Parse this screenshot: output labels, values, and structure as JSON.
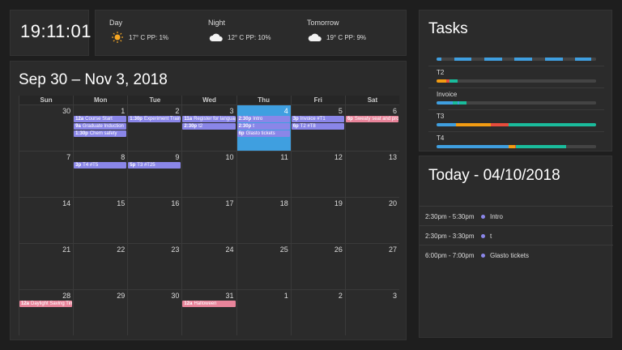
{
  "clock": {
    "time": "19:11:01"
  },
  "weather": [
    {
      "label": "Day",
      "icon": "sun-icon",
      "text": "17° C PP: 1%"
    },
    {
      "label": "Night",
      "icon": "cloud-icon",
      "text": "12° C PP: 10%"
    },
    {
      "label": "Tomorrow",
      "icon": "cloud-icon",
      "text": "19° C PP: 9%"
    }
  ],
  "calendar": {
    "title": "Sep 30 – Nov 3, 2018",
    "weekdays": [
      "Sun",
      "Mon",
      "Tue",
      "Wed",
      "Thu",
      "Fri",
      "Sat"
    ],
    "weeks": [
      [
        30,
        1,
        2,
        3,
        4,
        5,
        6
      ],
      [
        7,
        8,
        9,
        10,
        11,
        12,
        13
      ],
      [
        14,
        15,
        16,
        17,
        18,
        19,
        20
      ],
      [
        21,
        22,
        23,
        24,
        25,
        26,
        27
      ],
      [
        28,
        29,
        30,
        31,
        1,
        2,
        3
      ]
    ],
    "today": {
      "week": 0,
      "day": 4
    },
    "events": [
      {
        "week": 0,
        "day": 1,
        "slot": 0,
        "time": "12a",
        "title": "Course Start",
        "color": "purple"
      },
      {
        "week": 0,
        "day": 1,
        "slot": 1,
        "time": "9a",
        "title": "Graduate Induction",
        "color": "purple"
      },
      {
        "week": 0,
        "day": 1,
        "slot": 2,
        "time": "1:30p",
        "title": "Chem safety",
        "color": "purple"
      },
      {
        "week": 0,
        "day": 2,
        "slot": 0,
        "time": "1:30p",
        "title": "Experiment Training",
        "color": "purple"
      },
      {
        "week": 0,
        "day": 3,
        "slot": 0,
        "time": "11a",
        "title": "Register for language",
        "color": "purple"
      },
      {
        "week": 0,
        "day": 3,
        "slot": 1,
        "time": "2:30p",
        "title": "t2",
        "color": "purple"
      },
      {
        "week": 0,
        "day": 4,
        "slot": 0,
        "time": "2:30p",
        "title": "Intro",
        "color": "purple"
      },
      {
        "week": 0,
        "day": 4,
        "slot": 1,
        "time": "2:30p",
        "title": "t",
        "color": "purple"
      },
      {
        "week": 0,
        "day": 4,
        "slot": 2,
        "time": "6p",
        "title": "Glasto tickets",
        "color": "purple"
      },
      {
        "week": 0,
        "day": 5,
        "slot": 0,
        "time": "3p",
        "title": "Invoice #T1",
        "color": "purple"
      },
      {
        "week": 0,
        "day": 5,
        "slot": 1,
        "time": "6p",
        "title": "T2 #T8",
        "color": "purple"
      },
      {
        "week": 0,
        "day": 6,
        "slot": 0,
        "time": "6p",
        "title": "Sweaty seat and pro",
        "color": "pink"
      },
      {
        "week": 1,
        "day": 1,
        "slot": 0,
        "time": "3p",
        "title": "T4 #T5",
        "color": "purple"
      },
      {
        "week": 1,
        "day": 2,
        "slot": 0,
        "time": "5p",
        "title": "T3 #T25",
        "color": "purple"
      },
      {
        "week": 4,
        "day": 0,
        "slot": 0,
        "time": "12a",
        "title": "Daylight Saving Time",
        "color": "pink"
      },
      {
        "week": 4,
        "day": 3,
        "slot": 0,
        "time": "12a",
        "title": "Halloween",
        "color": "pink"
      }
    ],
    "colors": {
      "purple": "#8a86e8",
      "pink": "#e8849a",
      "today": "#3f9fe0"
    }
  },
  "tasks": {
    "title": "Tasks",
    "items": [
      {
        "label": "",
        "segments": [
          [
            "#3f9fe0",
            3
          ],
          [
            "#444",
            8
          ],
          [
            "#3f9fe0",
            11
          ],
          [
            "#444",
            8
          ],
          [
            "#3f9fe0",
            11
          ],
          [
            "#444",
            8
          ],
          [
            "#3f9fe0",
            11
          ],
          [
            "#444",
            8
          ],
          [
            "#3f9fe0",
            11
          ],
          [
            "#444",
            8
          ],
          [
            "#3f9fe0",
            10
          ],
          [
            "#444",
            3
          ]
        ]
      },
      {
        "label": "T2",
        "segments": [
          [
            "#f39c12",
            6
          ],
          [
            "#e74c3c",
            2
          ],
          [
            "#1abc9c",
            5
          ],
          [
            "#444",
            87
          ]
        ]
      },
      {
        "label": "Invoice",
        "segments": [
          [
            "#3f9fe0",
            10
          ],
          [
            "#1abc9c",
            3
          ],
          [
            "#3f9fe0",
            1
          ],
          [
            "#1abc9c",
            5
          ],
          [
            "#444",
            81
          ]
        ]
      },
      {
        "label": "T3",
        "segments": [
          [
            "#3f9fe0",
            12
          ],
          [
            "#f39c12",
            22
          ],
          [
            "#e74c3c",
            11
          ],
          [
            "#1abc9c",
            55
          ]
        ]
      },
      {
        "label": "T4",
        "segments": [
          [
            "#3f9fe0",
            45
          ],
          [
            "#f39c12",
            4
          ],
          [
            "#e74c3c",
            1
          ],
          [
            "#1abc9c",
            31
          ],
          [
            "#444",
            19
          ]
        ]
      }
    ]
  },
  "today": {
    "title": "Today - 04/10/2018",
    "events": [
      {
        "time": "2:30pm - 5:30pm",
        "title": "Intro"
      },
      {
        "time": "2:30pm - 3:30pm",
        "title": "t"
      },
      {
        "time": "6:00pm - 7:00pm",
        "title": "Glasto tickets"
      }
    ]
  }
}
